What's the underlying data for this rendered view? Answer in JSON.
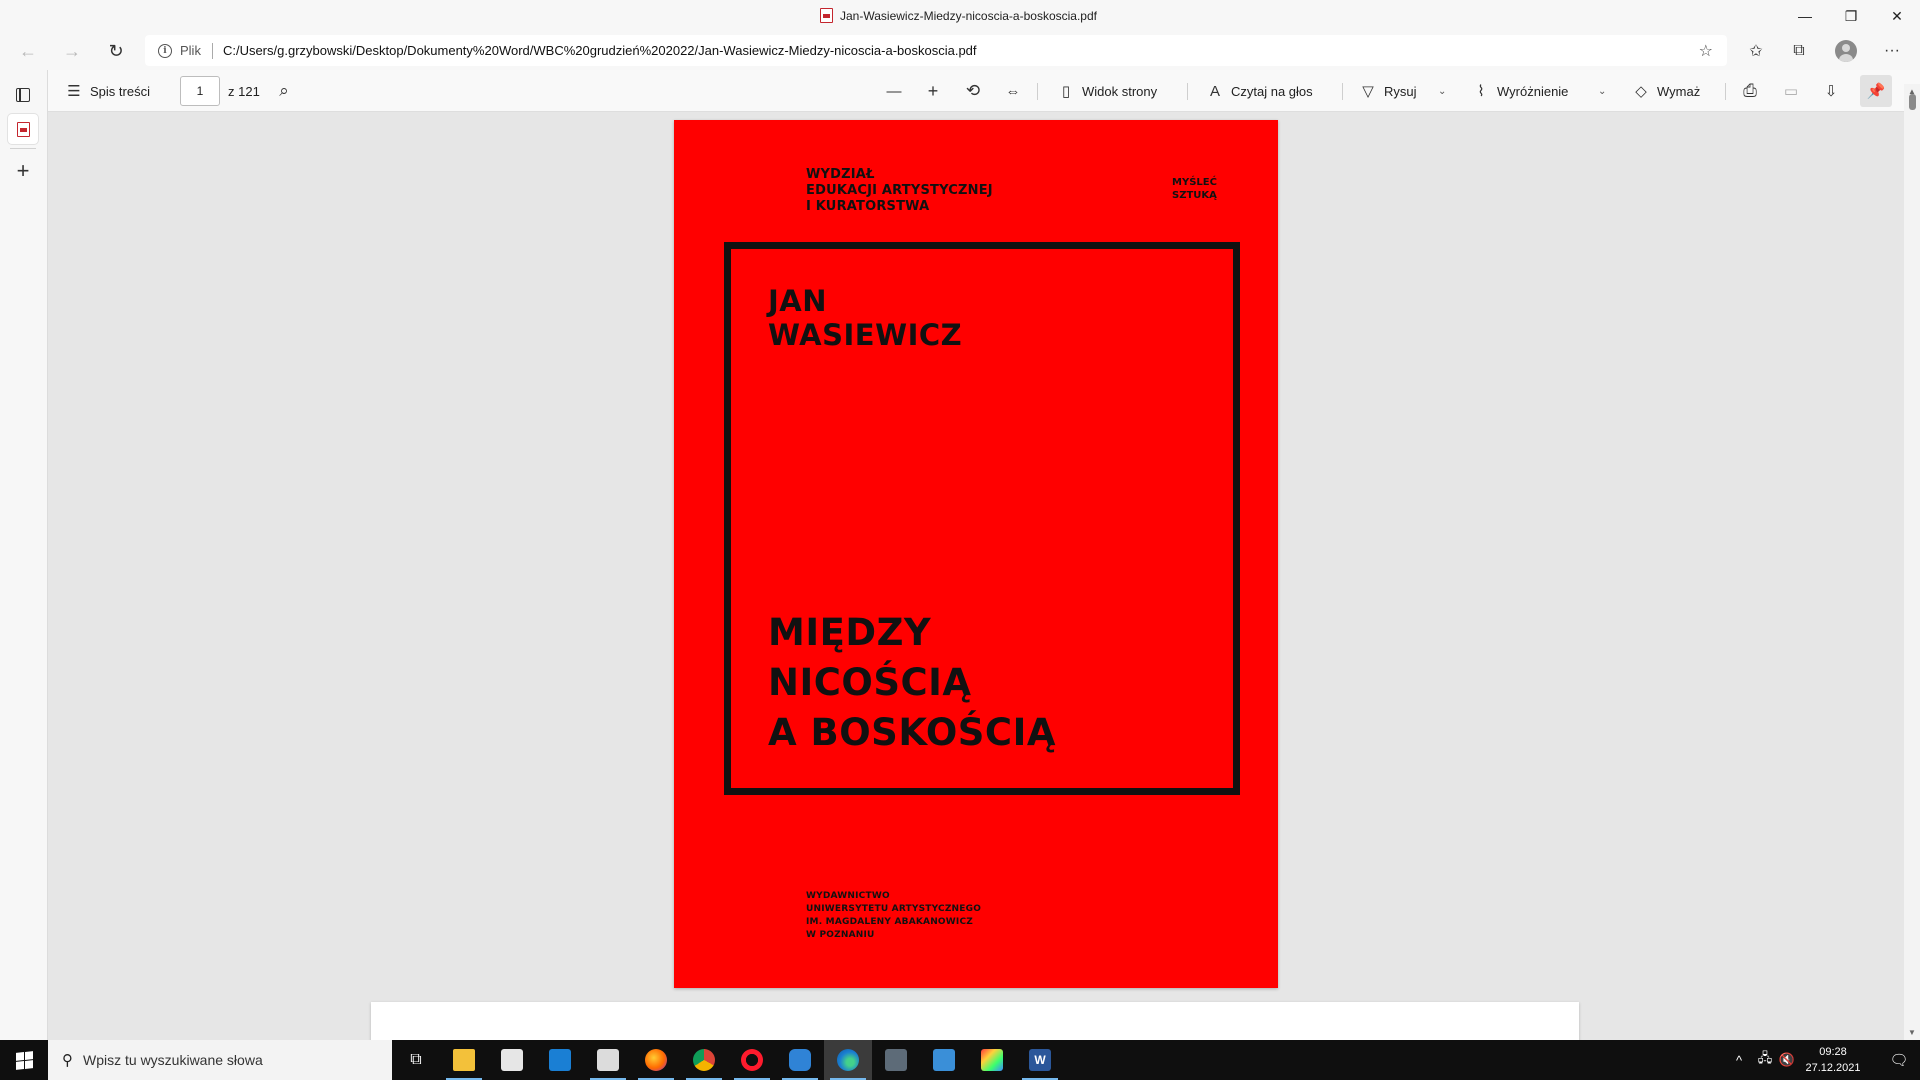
{
  "window": {
    "title": "Jan-Wasiewicz-Miedzy-nicoscia-a-boskoscia.pdf",
    "minimize": "—",
    "restore": "❐",
    "close": "✕"
  },
  "address_bar": {
    "back": "←",
    "forward": "→",
    "refresh": "↻",
    "info": "i",
    "scheme_label": "Plik",
    "url": "C:/Users/g.grzybowski/Desktop/Dokumenty%20Word/WBC%20grudzień%202022/Jan-Wasiewicz-Miedzy-nicoscia-a-boskoscia.pdf",
    "favorite_add": "☆",
    "favorites": "✩",
    "collections": "⧉",
    "more": "···"
  },
  "side_tabs": {
    "new_tab": "+"
  },
  "pdf_toolbar": {
    "toc_icon": "☰",
    "toc_label": "Spis treści",
    "page_value": "1",
    "page_total": "z 121",
    "search_icon": "⌕",
    "zoom_out": "—",
    "zoom_in": "+",
    "rotate": "⟲",
    "fit": "⇔",
    "page_view_icon": "▯",
    "page_view_label": "Widok strony",
    "read_aloud_icon": "A",
    "read_aloud_label": "Czytaj na głos",
    "draw_icon": "▽",
    "draw_label": "Rysuj",
    "highlight_icon": "⌇",
    "highlight_label": "Wyróżnienie",
    "erase_icon": "◇",
    "erase_label": "Wymaż",
    "chevron": "⌄",
    "print": "⎙",
    "save": "▭",
    "save_as": "⇩",
    "pin": "📌"
  },
  "document": {
    "faculty": "WYDZIAŁ\nEDUKACJI ARTYSTYCZNEJ\nI KURATORSTWA",
    "motto": "MYŚLEĆ\nSZTUKĄ",
    "author": "JAN\nWASIEWICZ",
    "title": "MIĘDZY\nNICOŚCIĄ\nA BOSKOŚCIĄ",
    "publisher": "WYDAWNICTWO\nUNIWERSYTETU ARTYSTYCZNEGO\nIM. MAGDALENY ABAKANOWICZ\nW POZNANIU"
  },
  "taskbar": {
    "search_placeholder": "Wpisz tu wyszukiwane słowa",
    "search_icon": "⚲",
    "task_view": "⧉",
    "word_letter": "W",
    "tray_chevron": "^",
    "network": "🖧",
    "volume": "🔇",
    "time": "09:28",
    "date": "27.12.2021",
    "notifications": "🗨"
  },
  "colors": {
    "cover_red": "#ff0000",
    "edge_blue": "#1b7fd1",
    "word_blue": "#2b579a"
  }
}
